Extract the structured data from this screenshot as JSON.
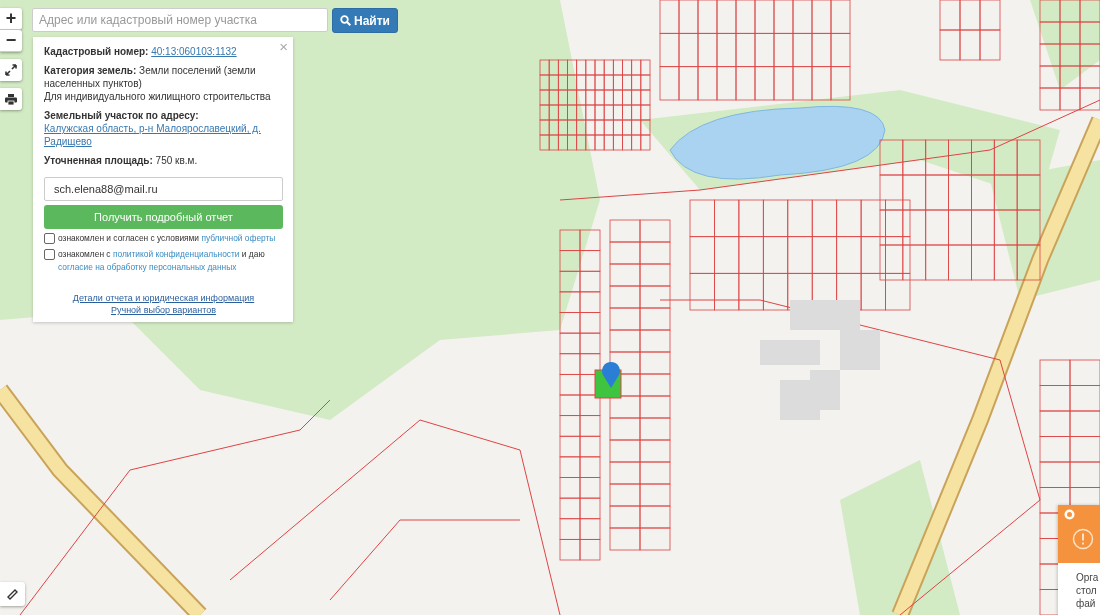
{
  "zoom_buttons": [
    "+",
    "−"
  ],
  "search": {
    "placeholder": "Адрес или кадастровый номер участка",
    "button": "Найти"
  },
  "info_panel": {
    "close": "×",
    "fields": [
      {
        "kind": "link",
        "label": "Кадастровый номер:",
        "value": "40:13:060103:1132"
      },
      {
        "kind": "text",
        "label": "Категория земель:",
        "value": "Земли поселений (земли населенных пунктов)"
      },
      {
        "kind": "plain",
        "value": "Для индивидуального жилищного строительства"
      },
      {
        "kind": "address",
        "label": "Земельный участок по адресу:",
        "value": "Калужская область, р-н Малоярославецкий, д. Радищево"
      },
      {
        "kind": "text",
        "label": "Уточненная площадь:",
        "value": "750 кв.м."
      }
    ],
    "email": {
      "value": "sch.elena88@mail.ru"
    },
    "submit": "Получить подробный отчет",
    "agreements": [
      {
        "checked": false,
        "parts": [
          {
            "text": "ознакомлен и согласен с условиями "
          },
          {
            "link": "публичной оферты"
          }
        ]
      },
      {
        "checked": false,
        "parts": [
          {
            "text": "ознакомлен с "
          },
          {
            "link": "политикой конфиденциальности"
          },
          {
            "text": " и даю "
          },
          {
            "link": "согласие на обработку персональных данных"
          }
        ]
      }
    ],
    "links": [
      "Детали отчета и юридическая информация",
      "Ручной выбор вариантов"
    ]
  },
  "notice": {
    "lines": [
      "Орга",
      "стол",
      "фай"
    ]
  }
}
